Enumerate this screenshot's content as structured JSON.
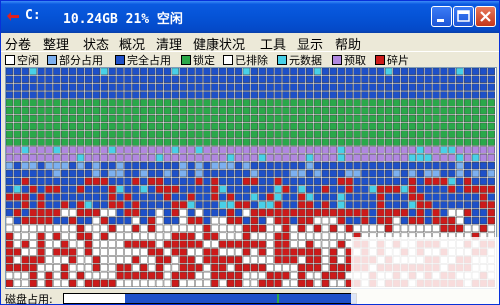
{
  "window": {
    "drive": "C:",
    "info": "10.24GB 21% 空闲"
  },
  "menu": [
    "分卷",
    "整理",
    "状态",
    "概况",
    "清理",
    "健康状况",
    "工具",
    "显示",
    "帮助"
  ],
  "legend": [
    {
      "label": "空闲",
      "color": "#ffffff"
    },
    {
      "label": "部分占用",
      "color": "#7cb0f0"
    },
    {
      "label": "完全占用",
      "color": "#1e50c8"
    },
    {
      "label": "锁定",
      "color": "#2aa84a"
    },
    {
      "label": "已排除",
      "color": "#ffffff"
    },
    {
      "label": "元数据",
      "color": "#48d0e8"
    },
    {
      "label": "预取",
      "color": "#b088e0"
    },
    {
      "label": "碎片",
      "color": "#cc1a1a"
    }
  ],
  "status": {
    "label": "磁盘占用:",
    "used_fraction": 0.79
  }
}
